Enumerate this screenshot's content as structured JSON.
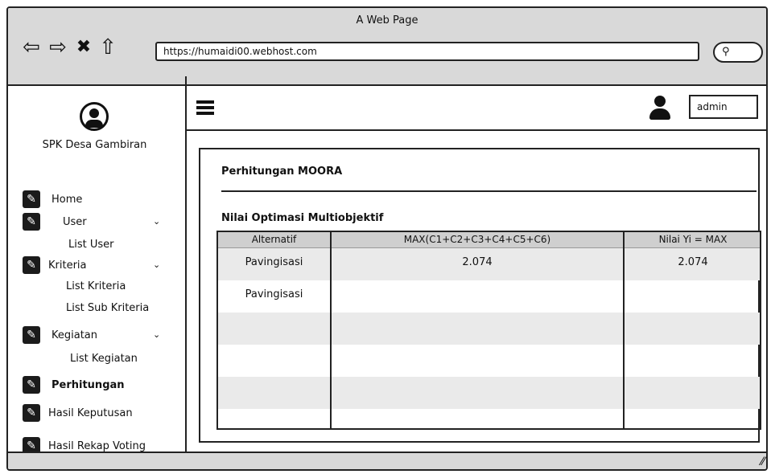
{
  "browser": {
    "page_title": "A Web Page",
    "url": "https://humaidi00.webhost.com"
  },
  "sidebar": {
    "brand": "SPK Desa Gambiran",
    "items": [
      {
        "label": "Home"
      },
      {
        "label": "User"
      },
      {
        "label": "List User"
      },
      {
        "label": "Kriteria"
      },
      {
        "label": "List Kriteria"
      },
      {
        "label": "List Sub Kriteria"
      },
      {
        "label": "Kegiatan"
      },
      {
        "label": "List Kegiatan"
      },
      {
        "label": "Perhitungan"
      },
      {
        "label": "Hasil Keputusan"
      },
      {
        "label": "Hasil Rekap Voting"
      }
    ]
  },
  "header": {
    "user_value": "admin"
  },
  "main": {
    "title": "Perhitungan MOORA",
    "section_title": "Nilai Optimasi Multiobjektif",
    "table": {
      "columns": [
        "Alternatif",
        "MAX(C1+C2+C3+C4+C5+C6)",
        "Nilai Yi = MAX"
      ],
      "rows": [
        [
          "Pavingisasi",
          "2.074",
          "2.074"
        ],
        [
          "Pavingisasi",
          "",
          ""
        ]
      ]
    }
  }
}
